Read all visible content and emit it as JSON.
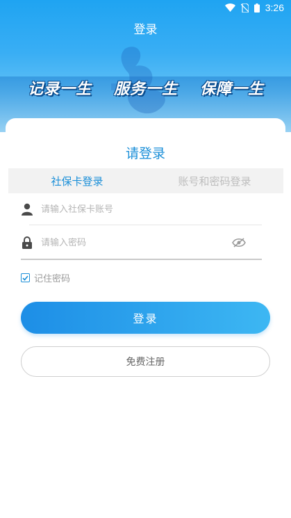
{
  "status_bar": {
    "time": "3:26",
    "icons": [
      "wifi-icon",
      "no-sim-icon",
      "battery-icon"
    ]
  },
  "header": {
    "title": "登录",
    "slogans": [
      "记录一生",
      "服务一生",
      "保障一生"
    ]
  },
  "login": {
    "heading": "请登录",
    "tabs": [
      {
        "label": "社保卡登录",
        "active": true
      },
      {
        "label": "账号和密码登录",
        "active": false
      }
    ],
    "account_placeholder": "请输入社保卡账号",
    "password_placeholder": "请输入密码",
    "remember_label": "记住密码",
    "remember_checked": true,
    "login_button": "登录",
    "register_button": "免费注册"
  },
  "colors": {
    "accent": "#1b8fd8",
    "banner_top": "#1fa4f2",
    "button_gradient_start": "#1d8ee6",
    "button_gradient_end": "#3db7f3"
  }
}
